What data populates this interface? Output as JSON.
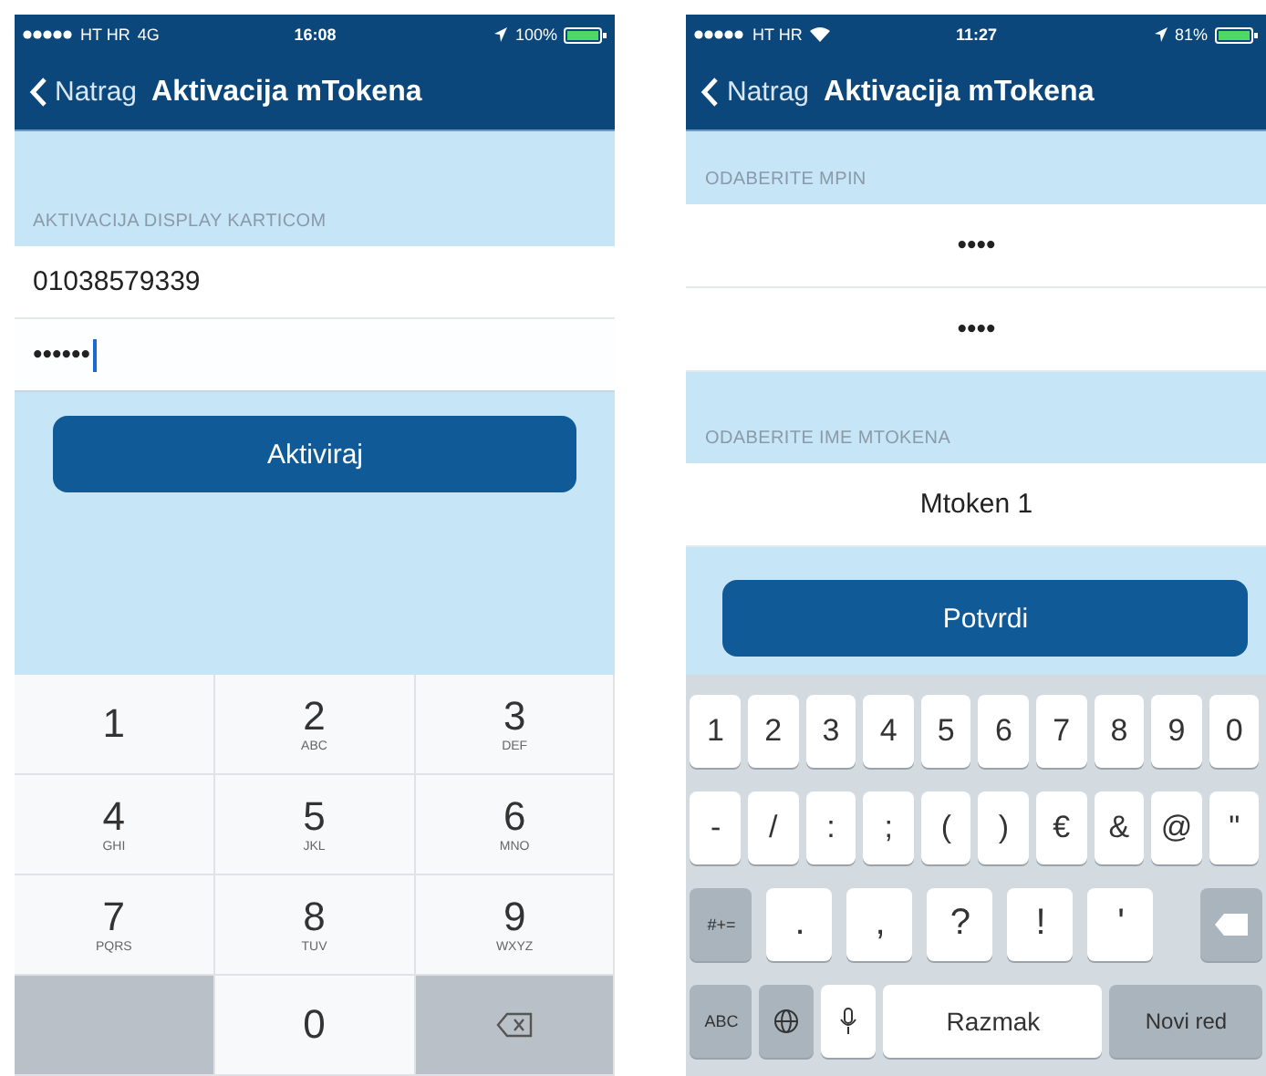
{
  "phones": [
    {
      "status_bar": {
        "carrier": "HT HR",
        "network": "4G",
        "wifi": false,
        "time": "16:08",
        "battery": "100%"
      },
      "nav": {
        "back": "Natrag",
        "title": "Aktivacija mTokena"
      },
      "centered": false,
      "form": [
        {
          "kind": "label",
          "text": "AKTIVACIJA DISPLAY KARTICOM"
        },
        {
          "kind": "field",
          "value": "01038579339",
          "focused": false
        },
        {
          "kind": "field",
          "value": "••••••",
          "focused": true
        },
        {
          "kind": "button",
          "text": "Aktiviraj"
        }
      ],
      "keyboard": {
        "kind": "numpad",
        "rows": [
          [
            {
              "kind": "digit",
              "label": "1"
            },
            {
              "kind": "digit",
              "label": "2",
              "letters": "ABC"
            },
            {
              "kind": "digit",
              "label": "3",
              "letters": "DEF"
            }
          ],
          [
            {
              "kind": "digit",
              "label": "4",
              "letters": "GHI"
            },
            {
              "kind": "digit",
              "label": "5",
              "letters": "JKL"
            },
            {
              "kind": "digit",
              "label": "6",
              "letters": "MNO"
            }
          ],
          [
            {
              "kind": "digit",
              "label": "7",
              "letters": "PQRS"
            },
            {
              "kind": "digit",
              "label": "8",
              "letters": "TUV"
            },
            {
              "kind": "digit",
              "label": "9",
              "letters": "WXYZ"
            }
          ],
          [
            {
              "kind": "blank"
            },
            {
              "kind": "digit",
              "label": "0"
            },
            {
              "kind": "delete"
            }
          ]
        ]
      }
    },
    {
      "status_bar": {
        "carrier": "HT HR",
        "wifi": true,
        "time": "11:27",
        "battery": "81%"
      },
      "nav": {
        "back": "Natrag",
        "title": "Aktivacija mTokena"
      },
      "centered": true,
      "form": [
        {
          "kind": "label",
          "text": "ODABERITE MPIN"
        },
        {
          "kind": "field",
          "value": "••••",
          "focused": false
        },
        {
          "kind": "field",
          "value": "••••",
          "focused": false
        },
        {
          "kind": "label",
          "text": "ODABERITE IME MTOKENA"
        },
        {
          "kind": "field",
          "value": "Mtoken 1",
          "focused": false
        },
        {
          "kind": "button",
          "text": "Potvrdi"
        }
      ],
      "keyboard": {
        "kind": "qwerty",
        "key_rows": [
          {
            "keys": [
              {
                "kind": "char",
                "label": "1"
              },
              {
                "kind": "char",
                "label": "2"
              },
              {
                "kind": "char",
                "label": "3"
              },
              {
                "kind": "char",
                "label": "4"
              },
              {
                "kind": "char",
                "label": "5"
              },
              {
                "kind": "char",
                "label": "6"
              },
              {
                "kind": "char",
                "label": "7"
              },
              {
                "kind": "char",
                "label": "8"
              },
              {
                "kind": "char",
                "label": "9"
              },
              {
                "kind": "char",
                "label": "0"
              }
            ]
          },
          {
            "keys": [
              {
                "kind": "char",
                "label": "-"
              },
              {
                "kind": "char",
                "label": "/"
              },
              {
                "kind": "char",
                "label": ":"
              },
              {
                "kind": "char",
                "label": ";"
              },
              {
                "kind": "char",
                "label": "("
              },
              {
                "kind": "char",
                "label": ")"
              },
              {
                "kind": "char",
                "label": "€"
              },
              {
                "kind": "char",
                "label": "&"
              },
              {
                "kind": "char",
                "label": "@"
              },
              {
                "kind": "char",
                "label": "\""
              }
            ]
          },
          {
            "keys": [
              {
                "kind": "function",
                "label": "#+="
              },
              {
                "kind": "wide",
                "label": "."
              },
              {
                "kind": "wide",
                "label": ","
              },
              {
                "kind": "wide",
                "label": "?"
              },
              {
                "kind": "wide",
                "label": "!"
              },
              {
                "kind": "wide",
                "label": "'"
              },
              {
                "kind": "delete"
              }
            ]
          },
          {
            "keys": [
              {
                "kind": "function",
                "label": "ABC"
              },
              {
                "kind": "globe"
              },
              {
                "kind": "mic"
              },
              {
                "kind": "space",
                "label": "Razmak"
              },
              {
                "kind": "return",
                "label": "Novi red"
              }
            ]
          }
        ]
      }
    }
  ]
}
